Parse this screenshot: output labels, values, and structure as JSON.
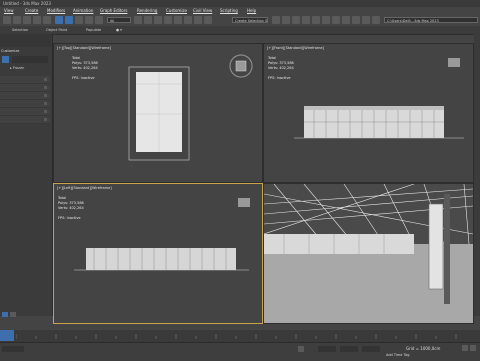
{
  "window": {
    "title": "Untitled - 3ds Max 2023"
  },
  "menu": {
    "items": [
      "View",
      "Create",
      "Modifiers",
      "Animation",
      "Graph Editors",
      "Rendering",
      "Customize",
      "Civil View",
      "Scripting",
      "Help"
    ]
  },
  "toolbar": {
    "filter_value": "All",
    "view_value": "View",
    "selection_set_placeholder": "Create Selection Se",
    "workspace_path": "C:\\Users\\Dell\\...3ds Max 2023"
  },
  "ribbon": {
    "tabs": [
      "Selection",
      "Object Paint",
      "Populate"
    ]
  },
  "scene_explorer": {
    "header": "Customize",
    "root_item": "Frozen"
  },
  "viewports": {
    "top": {
      "label": "[+][Top][Standard][Wireframe]"
    },
    "front": {
      "label": "[+][Front][Standard][Wireframe]"
    },
    "left": {
      "label": "[+][Left][Standard][Wireframe]"
    },
    "persp": {
      "label": ""
    }
  },
  "stats": {
    "total_label": "Total",
    "polys_label": "Polys:",
    "polys_value": "373,586",
    "verts_label": "Verts:",
    "verts_value": "402,264",
    "fps_label": "FPS:",
    "fps_value": "Inactive"
  },
  "status": {
    "grid_label": "Grid = 1000,0cm",
    "time_tag": "Add Time Tag"
  },
  "colors": {
    "background": "#444444",
    "active_viewport_border": "#c7a34a",
    "accent": "#3d6fae"
  }
}
